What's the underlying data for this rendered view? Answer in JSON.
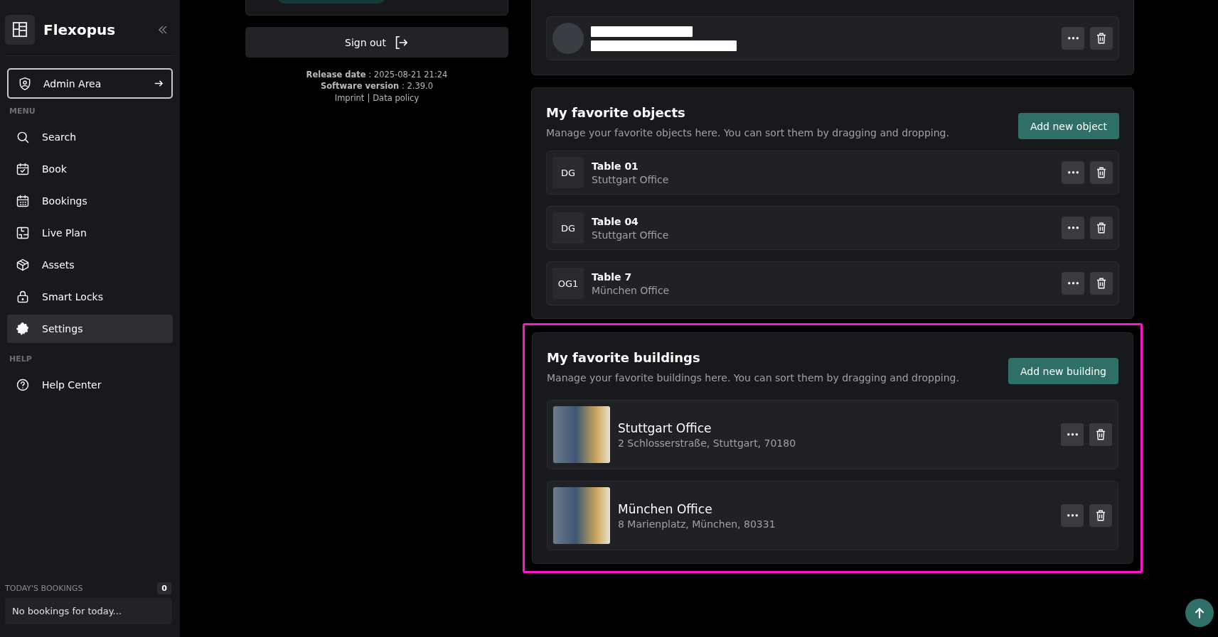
{
  "sidebar": {
    "brand": "Flexopus",
    "admin_button": "Admin Area",
    "menu_label": "MENU",
    "menu_items": [
      {
        "label": "Search",
        "kind": "search",
        "selected": false
      },
      {
        "label": "Book",
        "kind": "book",
        "selected": false
      },
      {
        "label": "Bookings",
        "kind": "bookings",
        "selected": false
      },
      {
        "label": "Live Plan",
        "kind": "plan",
        "selected": false
      },
      {
        "label": "Assets",
        "kind": "assets",
        "selected": false
      },
      {
        "label": "Smart Locks",
        "kind": "lock",
        "selected": false
      },
      {
        "label": "Settings",
        "kind": "settings",
        "selected": true
      }
    ],
    "help_label": "HELP",
    "help_items": [
      {
        "label": "Help Center",
        "kind": "help",
        "selected": false
      }
    ],
    "todays_bookings": {
      "label": "TODAY'S BOOKINGS",
      "count": "0",
      "empty_text": "No bookings for today..."
    }
  },
  "account": {
    "sign_out": "Sign out",
    "release_info": "**Release date** : 2025-08-21 21:24",
    "version_info": "**Software version** : 2.39.0",
    "links": [
      "Imprint",
      "Data policy"
    ],
    "link_separator": "|"
  },
  "favorite_objects": {
    "title": "My favorite objects",
    "description": "Manage your favorite objects here. You can sort them by dragging and dropping.",
    "add_button": "Add new object",
    "items": [
      {
        "badge": "DG",
        "name": "Table 01",
        "location": "Stuttgart Office"
      },
      {
        "badge": "DG",
        "name": "Table 04",
        "location": "Stuttgart Office"
      },
      {
        "badge": "OG1",
        "name": "Table 7",
        "location": "München Office"
      }
    ]
  },
  "favorite_buildings": {
    "highlighted": true,
    "title": "My favorite buildings",
    "description": "Manage your favorite buildings here. You can sort them by dragging and dropping.",
    "add_button": "Add new building",
    "items": [
      {
        "name": "Stuttgart Office",
        "address": "2 Schlosserstraße, Stuttgart, 70180"
      },
      {
        "name": "München Office",
        "address": "8 Marienplatz, München, 80331"
      }
    ]
  }
}
